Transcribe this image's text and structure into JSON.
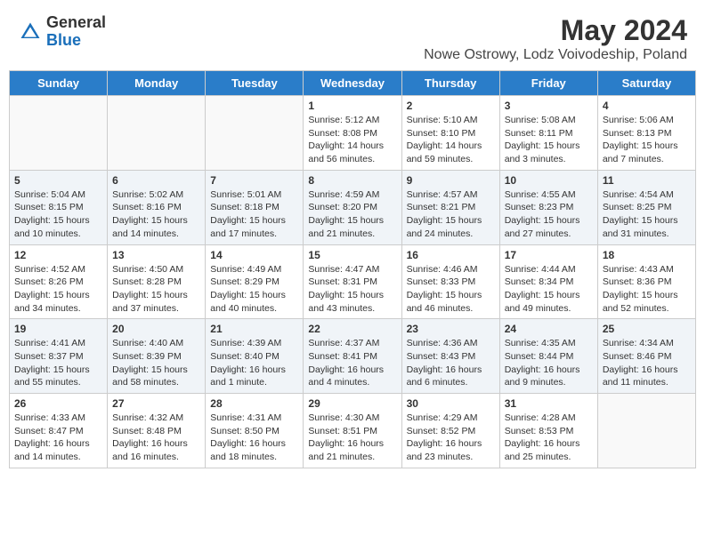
{
  "logo": {
    "general": "General",
    "blue": "Blue"
  },
  "title": "May 2024",
  "location": "Nowe Ostrowy, Lodz Voivodeship, Poland",
  "days_of_week": [
    "Sunday",
    "Monday",
    "Tuesday",
    "Wednesday",
    "Thursday",
    "Friday",
    "Saturday"
  ],
  "weeks": [
    [
      {
        "day": "",
        "info": ""
      },
      {
        "day": "",
        "info": ""
      },
      {
        "day": "",
        "info": ""
      },
      {
        "day": "1",
        "info": "Sunrise: 5:12 AM\nSunset: 8:08 PM\nDaylight: 14 hours and 56 minutes."
      },
      {
        "day": "2",
        "info": "Sunrise: 5:10 AM\nSunset: 8:10 PM\nDaylight: 14 hours and 59 minutes."
      },
      {
        "day": "3",
        "info": "Sunrise: 5:08 AM\nSunset: 8:11 PM\nDaylight: 15 hours and 3 minutes."
      },
      {
        "day": "4",
        "info": "Sunrise: 5:06 AM\nSunset: 8:13 PM\nDaylight: 15 hours and 7 minutes."
      }
    ],
    [
      {
        "day": "5",
        "info": "Sunrise: 5:04 AM\nSunset: 8:15 PM\nDaylight: 15 hours and 10 minutes."
      },
      {
        "day": "6",
        "info": "Sunrise: 5:02 AM\nSunset: 8:16 PM\nDaylight: 15 hours and 14 minutes."
      },
      {
        "day": "7",
        "info": "Sunrise: 5:01 AM\nSunset: 8:18 PM\nDaylight: 15 hours and 17 minutes."
      },
      {
        "day": "8",
        "info": "Sunrise: 4:59 AM\nSunset: 8:20 PM\nDaylight: 15 hours and 21 minutes."
      },
      {
        "day": "9",
        "info": "Sunrise: 4:57 AM\nSunset: 8:21 PM\nDaylight: 15 hours and 24 minutes."
      },
      {
        "day": "10",
        "info": "Sunrise: 4:55 AM\nSunset: 8:23 PM\nDaylight: 15 hours and 27 minutes."
      },
      {
        "day": "11",
        "info": "Sunrise: 4:54 AM\nSunset: 8:25 PM\nDaylight: 15 hours and 31 minutes."
      }
    ],
    [
      {
        "day": "12",
        "info": "Sunrise: 4:52 AM\nSunset: 8:26 PM\nDaylight: 15 hours and 34 minutes."
      },
      {
        "day": "13",
        "info": "Sunrise: 4:50 AM\nSunset: 8:28 PM\nDaylight: 15 hours and 37 minutes."
      },
      {
        "day": "14",
        "info": "Sunrise: 4:49 AM\nSunset: 8:29 PM\nDaylight: 15 hours and 40 minutes."
      },
      {
        "day": "15",
        "info": "Sunrise: 4:47 AM\nSunset: 8:31 PM\nDaylight: 15 hours and 43 minutes."
      },
      {
        "day": "16",
        "info": "Sunrise: 4:46 AM\nSunset: 8:33 PM\nDaylight: 15 hours and 46 minutes."
      },
      {
        "day": "17",
        "info": "Sunrise: 4:44 AM\nSunset: 8:34 PM\nDaylight: 15 hours and 49 minutes."
      },
      {
        "day": "18",
        "info": "Sunrise: 4:43 AM\nSunset: 8:36 PM\nDaylight: 15 hours and 52 minutes."
      }
    ],
    [
      {
        "day": "19",
        "info": "Sunrise: 4:41 AM\nSunset: 8:37 PM\nDaylight: 15 hours and 55 minutes."
      },
      {
        "day": "20",
        "info": "Sunrise: 4:40 AM\nSunset: 8:39 PM\nDaylight: 15 hours and 58 minutes."
      },
      {
        "day": "21",
        "info": "Sunrise: 4:39 AM\nSunset: 8:40 PM\nDaylight: 16 hours and 1 minute."
      },
      {
        "day": "22",
        "info": "Sunrise: 4:37 AM\nSunset: 8:41 PM\nDaylight: 16 hours and 4 minutes."
      },
      {
        "day": "23",
        "info": "Sunrise: 4:36 AM\nSunset: 8:43 PM\nDaylight: 16 hours and 6 minutes."
      },
      {
        "day": "24",
        "info": "Sunrise: 4:35 AM\nSunset: 8:44 PM\nDaylight: 16 hours and 9 minutes."
      },
      {
        "day": "25",
        "info": "Sunrise: 4:34 AM\nSunset: 8:46 PM\nDaylight: 16 hours and 11 minutes."
      }
    ],
    [
      {
        "day": "26",
        "info": "Sunrise: 4:33 AM\nSunset: 8:47 PM\nDaylight: 16 hours and 14 minutes."
      },
      {
        "day": "27",
        "info": "Sunrise: 4:32 AM\nSunset: 8:48 PM\nDaylight: 16 hours and 16 minutes."
      },
      {
        "day": "28",
        "info": "Sunrise: 4:31 AM\nSunset: 8:50 PM\nDaylight: 16 hours and 18 minutes."
      },
      {
        "day": "29",
        "info": "Sunrise: 4:30 AM\nSunset: 8:51 PM\nDaylight: 16 hours and 21 minutes."
      },
      {
        "day": "30",
        "info": "Sunrise: 4:29 AM\nSunset: 8:52 PM\nDaylight: 16 hours and 23 minutes."
      },
      {
        "day": "31",
        "info": "Sunrise: 4:28 AM\nSunset: 8:53 PM\nDaylight: 16 hours and 25 minutes."
      },
      {
        "day": "",
        "info": ""
      }
    ]
  ]
}
